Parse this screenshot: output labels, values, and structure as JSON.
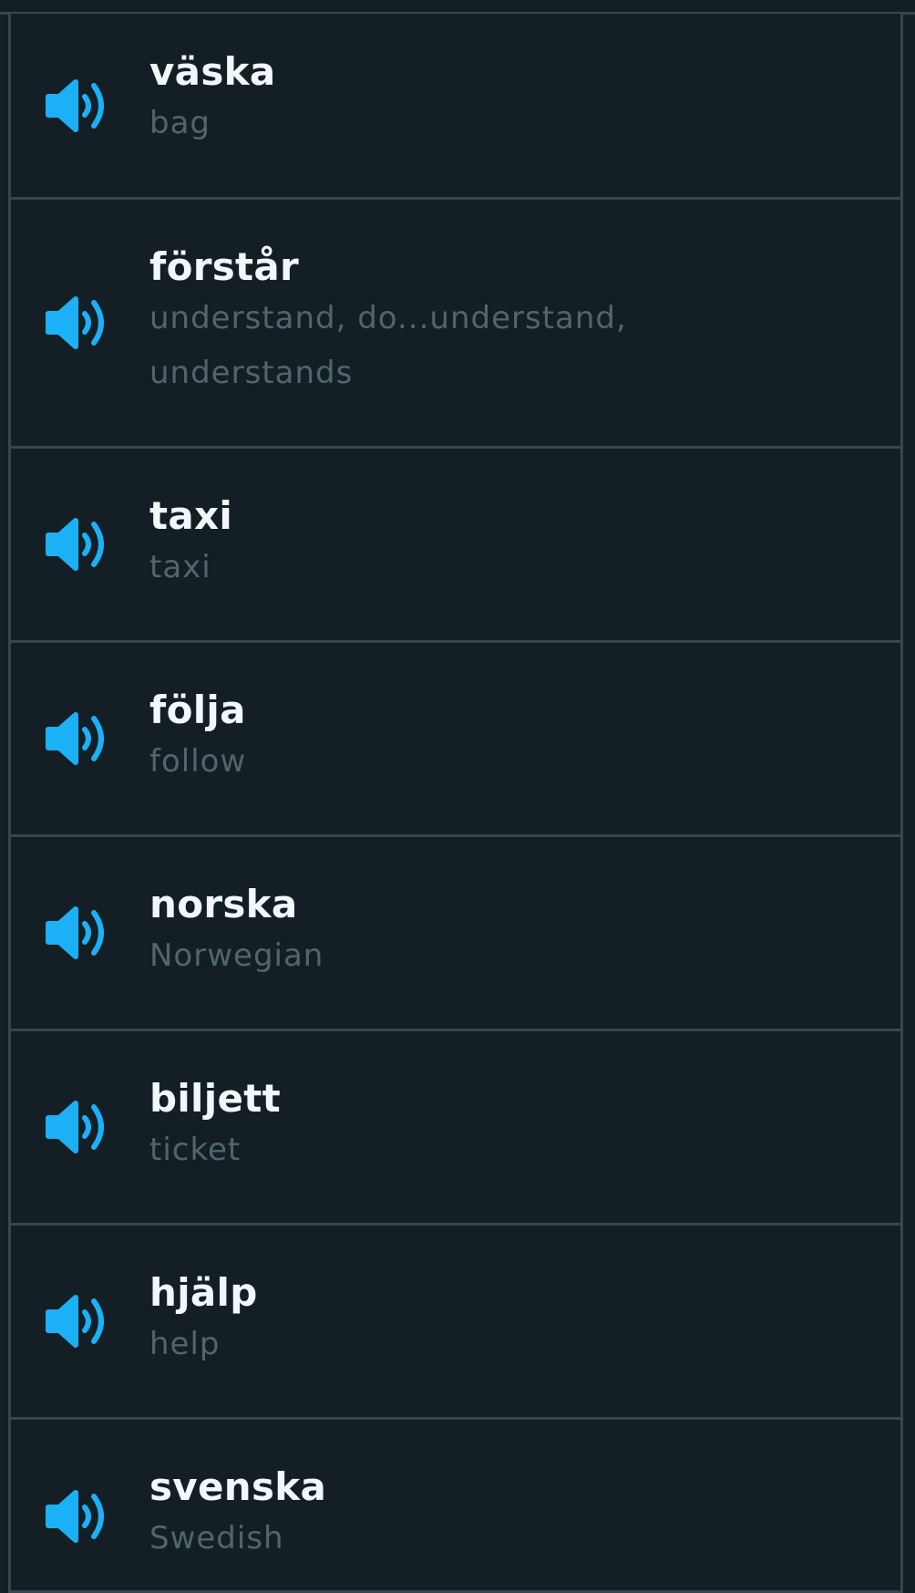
{
  "accent": "#1cb0f6",
  "words": [
    {
      "word": "väska",
      "translation": "bag",
      "icon": "speaker-icon"
    },
    {
      "word": "förstår",
      "translation": "understand, do...understand, understands",
      "icon": "speaker-icon"
    },
    {
      "word": "taxi",
      "translation": "taxi",
      "icon": "speaker-icon"
    },
    {
      "word": "följa",
      "translation": "follow",
      "icon": "speaker-icon"
    },
    {
      "word": "norska",
      "translation": "Norwegian",
      "icon": "speaker-icon"
    },
    {
      "word": "biljett",
      "translation": "ticket",
      "icon": "speaker-icon"
    },
    {
      "word": "hjälp",
      "translation": "help",
      "icon": "speaker-icon"
    },
    {
      "word": "svenska",
      "translation": "Swedish",
      "icon": "speaker-icon"
    }
  ]
}
